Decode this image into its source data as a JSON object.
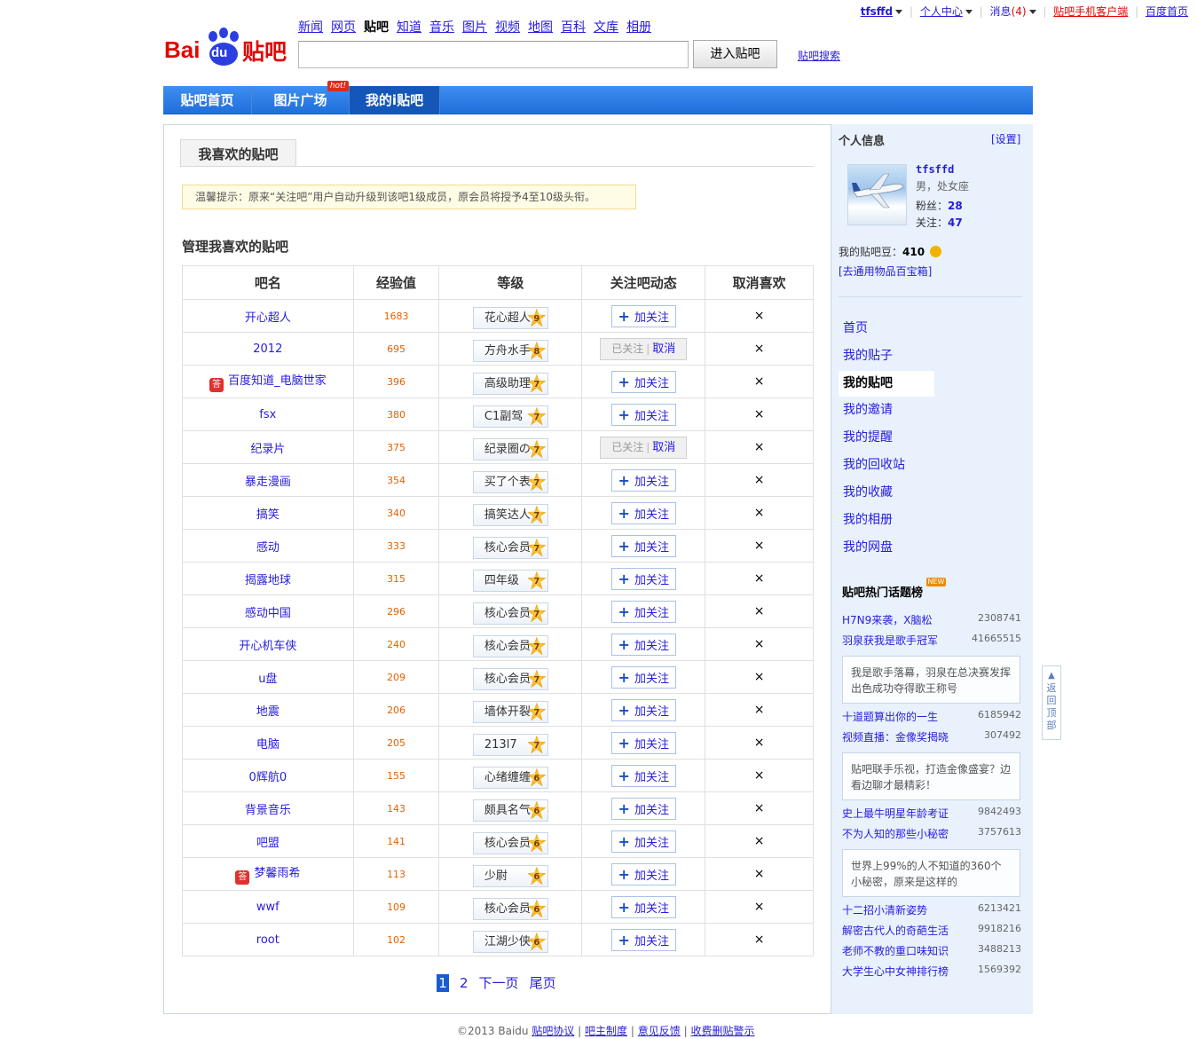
{
  "topbar": {
    "username": "tfsffd",
    "personal_center": "个人中心",
    "messages": "消息",
    "message_count": "(4)",
    "mobile_client": "贴吧手机客户端",
    "baidu_home": "百度首页"
  },
  "logo": {
    "text_bai": "Bai",
    "text_du": "du",
    "text_tieba": "贴吧"
  },
  "nav": [
    "新闻",
    "网页",
    "贴吧",
    "知道",
    "音乐",
    "图片",
    "视频",
    "地图",
    "百科",
    "文库",
    "相册"
  ],
  "search": {
    "placeholder": "",
    "button": "进入贴吧",
    "advanced": "贴吧搜索"
  },
  "tabs": [
    "贴吧首页",
    "图片广场",
    "我的i贴吧"
  ],
  "hot_badge": "hot!",
  "content": {
    "tab": "我喜欢的贴吧",
    "tip": "温馨提示：原来“关注吧”用户自动升级到该吧1级成员，原会员将授予4至10级头衔。",
    "section_title": "管理我喜欢的贴吧",
    "columns": [
      "吧名",
      "经验值",
      "等级",
      "关注吧动态",
      "取消喜欢"
    ],
    "follow_label": "加关注",
    "followed_label": "已关注",
    "cancel_label": "取消",
    "remove_symbol": "×",
    "rows": [
      {
        "name": "开心超人",
        "exp": "1683",
        "title": "花心超人",
        "level": "9",
        "followed": false,
        "icon": false
      },
      {
        "name": "2012",
        "exp": "695",
        "title": "方舟水手",
        "level": "8",
        "followed": true,
        "icon": false
      },
      {
        "name": "百度知道_电脑世家",
        "exp": "396",
        "title": "高级助理",
        "level": "7",
        "followed": false,
        "icon": true
      },
      {
        "name": "fsx",
        "exp": "380",
        "title": "C1副驾",
        "level": "7",
        "followed": false,
        "icon": false
      },
      {
        "name": "纪录片",
        "exp": "375",
        "title": "纪录圈の",
        "level": "7",
        "followed": true,
        "icon": false
      },
      {
        "name": "暴走漫画",
        "exp": "354",
        "title": "买了个表",
        "level": "7",
        "followed": false,
        "icon": false
      },
      {
        "name": "搞笑",
        "exp": "340",
        "title": "搞笑达人",
        "level": "7",
        "followed": false,
        "icon": false
      },
      {
        "name": "感动",
        "exp": "333",
        "title": "核心会员",
        "level": "7",
        "followed": false,
        "icon": false
      },
      {
        "name": "揭露地球",
        "exp": "315",
        "title": "四年级",
        "level": "7",
        "followed": false,
        "icon": false
      },
      {
        "name": "感动中国",
        "exp": "296",
        "title": "核心会员",
        "level": "7",
        "followed": false,
        "icon": false
      },
      {
        "name": "开心机车侠",
        "exp": "240",
        "title": "核心会员",
        "level": "7",
        "followed": false,
        "icon": false
      },
      {
        "name": "u盘",
        "exp": "209",
        "title": "核心会员",
        "level": "7",
        "followed": false,
        "icon": false
      },
      {
        "name": "地震",
        "exp": "206",
        "title": "墙体开裂",
        "level": "7",
        "followed": false,
        "icon": false
      },
      {
        "name": "电脑",
        "exp": "205",
        "title": "213l7",
        "level": "7",
        "followed": false,
        "icon": false
      },
      {
        "name": "0辉航0",
        "exp": "155",
        "title": "心绪缠缠",
        "level": "6",
        "followed": false,
        "icon": false
      },
      {
        "name": "背景音乐",
        "exp": "143",
        "title": "颇具名气",
        "level": "6",
        "followed": false,
        "icon": false
      },
      {
        "name": "吧盟",
        "exp": "141",
        "title": "核心会员",
        "level": "6",
        "followed": false,
        "icon": false
      },
      {
        "name": "梦馨雨希",
        "exp": "113",
        "title": "少尉",
        "level": "6",
        "followed": false,
        "icon": true
      },
      {
        "name": "wwf",
        "exp": "109",
        "title": "核心会员",
        "level": "6",
        "followed": false,
        "icon": false
      },
      {
        "name": "root",
        "exp": "102",
        "title": "江湖少侠",
        "level": "6",
        "followed": false,
        "icon": false
      }
    ],
    "icon_char": "答"
  },
  "pager": {
    "current": "1",
    "page2": "2",
    "next": "下一页",
    "last": "尾页"
  },
  "footer": {
    "copyright": "©2013 Baidu",
    "links": [
      "贴吧协议",
      "吧主制度",
      "意见反馈",
      "收费删贴警示"
    ],
    "sep": "|"
  },
  "sidebar": {
    "title": "个人信息",
    "settings": "[设置]",
    "username": "tfsffd",
    "gender_constellation": "男，处女座",
    "fans_label": "粉丝：",
    "fans": "28",
    "follow_label": "关注：",
    "follow": "47",
    "beans_label": "我的贴吧豆：",
    "beans": "410",
    "treasure_box": "[去通用物品百宝箱]",
    "menu": [
      "首页",
      "我的贴子",
      "我的贴吧",
      "我的邀请",
      "我的提醒",
      "我的回收站",
      "我的收藏",
      "我的相册",
      "我的网盘"
    ],
    "menu_current": 2,
    "hot_title": "贴吧热门话题榜",
    "new_badge": "NEW",
    "hot_groups": [
      {
        "items": [
          {
            "t": "H7N9来袭，X脑松",
            "n": "2308741"
          },
          {
            "t": "羽泉获我是歌手冠军",
            "n": "41665515"
          }
        ],
        "desc": "我是歌手落幕，羽泉在总决赛发挥出色成功夺得歌王称号"
      },
      {
        "items": [
          {
            "t": "十道题算出你的一生",
            "n": "6185942"
          },
          {
            "t": "视频直播：金像奖揭晓",
            "n": "307492"
          }
        ],
        "desc": "贴吧联手乐视，打造金像盛宴？边看边聊才最精彩！"
      },
      {
        "items": [
          {
            "t": "史上最牛明星年龄考证",
            "n": "9842493"
          },
          {
            "t": "不为人知的那些小秘密",
            "n": "3757613"
          }
        ],
        "desc": "世界上99%的人不知道的360个小秘密，原来是这样的"
      },
      {
        "items": [
          {
            "t": "十二招小清新姿势",
            "n": "6213421"
          },
          {
            "t": "解密古代人的奇葩生活",
            "n": "9918216"
          },
          {
            "t": "老师不教的重口味知识",
            "n": "3488213"
          },
          {
            "t": "大学生心中女神排行榜",
            "n": "1569392"
          }
        ],
        "desc": ""
      }
    ]
  },
  "back_to_top": "返回顶部",
  "colors": {
    "accent": "#1f6fdc",
    "link": "#261cdc",
    "exp": "#e66100",
    "sidebar_bg": "#e8f1fc"
  }
}
